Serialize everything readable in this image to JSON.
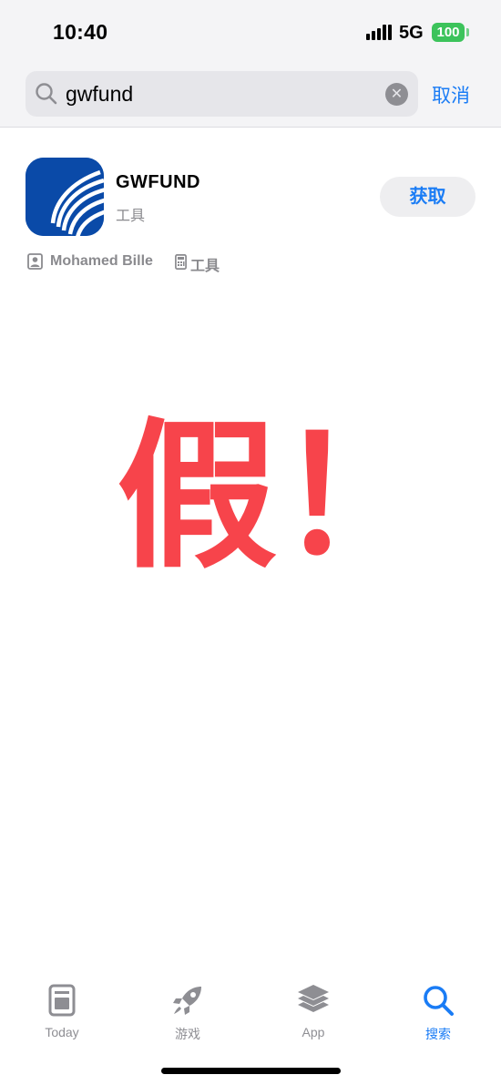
{
  "status_bar": {
    "time": "10:40",
    "network": "5G",
    "battery": "100"
  },
  "search": {
    "query": "gwfund",
    "cancel_label": "取消"
  },
  "result": {
    "name": "GWFUND",
    "category": "工具",
    "get_label": "获取",
    "developer": "Mohamed Bille",
    "meta_category": "工具"
  },
  "overlay_text": "假！",
  "tab_bar": {
    "tabs": [
      {
        "label": "Today",
        "icon": "today-icon",
        "active": false
      },
      {
        "label": "游戏",
        "icon": "rocket-icon",
        "active": false
      },
      {
        "label": "App",
        "icon": "layers-icon",
        "active": false
      },
      {
        "label": "搜索",
        "icon": "search-icon",
        "active": true
      }
    ]
  },
  "colors": {
    "accent": "#1a7cf5",
    "overlay": "#f7444b",
    "app_icon_bg": "#0a4aa8",
    "battery": "#3cc35b"
  }
}
